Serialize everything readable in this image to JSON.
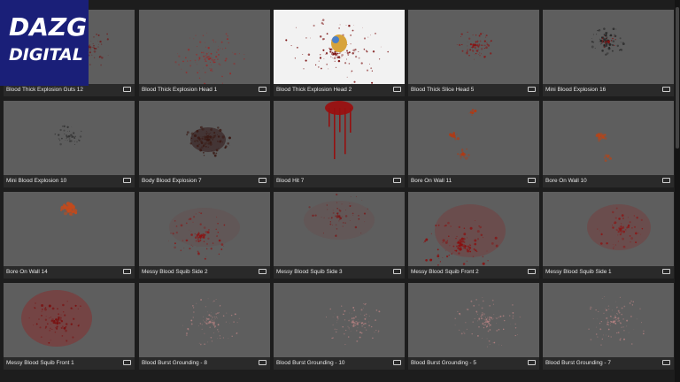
{
  "logo": {
    "line1": "DAZG",
    "line2": "DIGITAL"
  },
  "tiles": [
    {
      "label": "Blood Thick Explosion Guts 12"
    },
    {
      "label": "Blood Thick Explosion Head 1"
    },
    {
      "label": "Blood Thick Explosion Head 2"
    },
    {
      "label": "Blood Thick Slice Head 5"
    },
    {
      "label": "Mini Blood Explosion 16"
    },
    {
      "label": "Mini Blood Explosion 10"
    },
    {
      "label": "Body Blood Explosion 7"
    },
    {
      "label": "Blood Hit 7"
    },
    {
      "label": "Bore On Wall 11"
    },
    {
      "label": "Bore On Wall 10"
    },
    {
      "label": "Bore On Wall 14"
    },
    {
      "label": "Messy Blood Squib Side 2"
    },
    {
      "label": "Messy Blood Squib Side 3"
    },
    {
      "label": "Messy Blood Squib Front 2"
    },
    {
      "label": "Messy Blood Squib Side 1"
    },
    {
      "label": "Messy Blood Squib Front 1"
    },
    {
      "label": "Blood Burst Grounding - 8"
    },
    {
      "label": "Blood Burst Grounding - 10"
    },
    {
      "label": "Blood Burst Grounding - 5"
    },
    {
      "label": "Blood Burst Grounding - 7"
    }
  ],
  "colors": {
    "thumb_bg": "#5e5e5e",
    "blood": "#8a1414",
    "logo_bg": "#1a1f78"
  }
}
